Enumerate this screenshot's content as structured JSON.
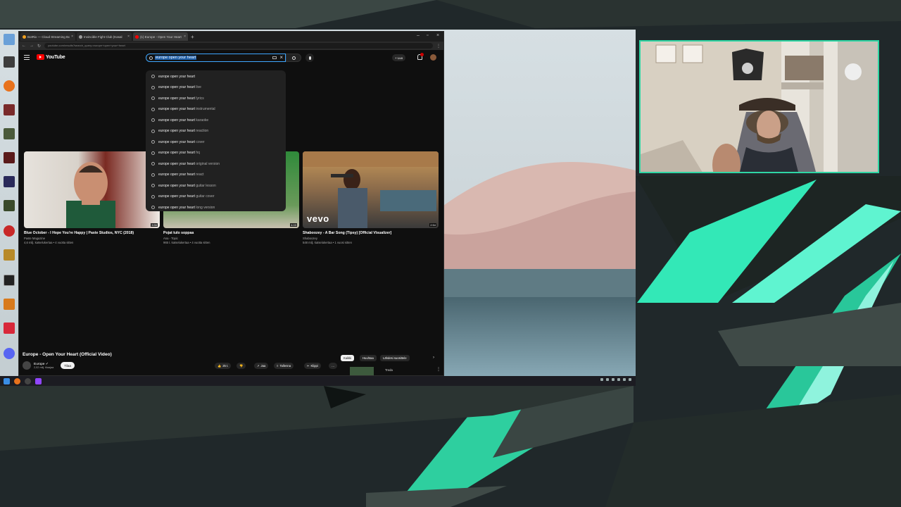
{
  "browser": {
    "tabs": [
      {
        "title": "BotRix — Cloud Streaming Bot",
        "color": "#f0a020"
      },
      {
        "title": "Invincible Fight Club (Kasal",
        "color": "#999999"
      },
      {
        "title": "(1) Europe - Open Your Heart",
        "color": "#ff0000"
      }
    ],
    "new_tab": "+",
    "url": "youtube.com/results?search_query=europe+open+your+heart"
  },
  "youtube": {
    "logo": "YouTube",
    "search": {
      "value": "europe open your heart",
      "clear": "×"
    },
    "create_label": "Luo",
    "suggestions": [
      {
        "bold": "europe open your heart",
        "rest": ""
      },
      {
        "bold": "europe open your heart",
        "rest": " live"
      },
      {
        "bold": "europe open your heart",
        "rest": " lyrics"
      },
      {
        "bold": "europe open your heart",
        "rest": " instrumental"
      },
      {
        "bold": "europe open your heart",
        "rest": " karaoke"
      },
      {
        "bold": "europe open your heart",
        "rest": " reaction"
      },
      {
        "bold": "europe open your heart",
        "rest": " cover"
      },
      {
        "bold": "europe open your heart",
        "rest": " hq"
      },
      {
        "bold": "europe open your heart",
        "rest": " original version"
      },
      {
        "bold": "europe open your heart",
        "rest": " react"
      },
      {
        "bold": "europe open your heart",
        "rest": " guitar lesson"
      },
      {
        "bold": "europe open your heart",
        "rest": " guitar cover"
      },
      {
        "bold": "europe open your heart",
        "rest": " long version"
      }
    ],
    "videos": [
      {
        "title": "Blue October - I Hope You're Happy | Paste Studios, NYC (2018)",
        "channel": "Paste Magazine",
        "meta": "4,6 milj. katselukertaa • 4 vuotta sitten",
        "duration": "3:56"
      },
      {
        "title": "Pojat tulo soppaa",
        "channel": "Ana - Topic",
        "meta": "965 t. katselukertaa • 4 vuotta sitten",
        "duration": "4:03"
      },
      {
        "title": "Shaboozey - A Bar Song (Tipsy) [Official Visualizer]",
        "channel": "Shaboozey",
        "meta": "548 milj. katselukertaa • 1 vuosi sitten",
        "duration": "2:54",
        "badge": "vevo"
      }
    ],
    "player": {
      "title": "Europe - Open Your Heart (Official Video)",
      "channel": "Europe ✓",
      "subs": "2,02 milj. tilaajaa",
      "subscribe": "Tilaa",
      "actions": [
        "25 t.",
        "",
        "Jaa",
        "Tallenna",
        "Klippi",
        "…"
      ],
      "chips": [
        "Kaikki",
        "Huuhtaa",
        "Lähdesi suosittele"
      ],
      "rec_title": "Treda"
    }
  },
  "colors": {
    "accent_green": "#2fd6a4",
    "yt_red": "#ff0000",
    "search_focus": "#3ea6ff"
  }
}
